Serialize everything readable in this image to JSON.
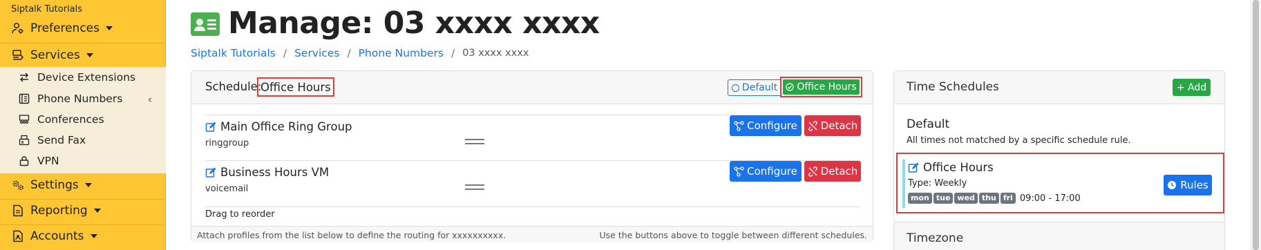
{
  "sidebar": {
    "brand": "Siptalk Tutorials",
    "items": [
      {
        "label": "Preferences",
        "icon": "user-gear-icon"
      },
      {
        "label": "Services",
        "icon": "services-icon"
      },
      {
        "label": "Settings",
        "icon": "gears-icon"
      },
      {
        "label": "Reporting",
        "icon": "report-icon"
      },
      {
        "label": "Accounts",
        "icon": "accounts-icon"
      }
    ],
    "services_submenu": [
      {
        "label": "Device Extensions",
        "icon": "arrows-exchange-icon"
      },
      {
        "label": "Phone Numbers",
        "icon": "phone-numbers-icon"
      },
      {
        "label": "Conferences",
        "icon": "conference-icon"
      },
      {
        "label": "Send Fax",
        "icon": "fax-icon"
      },
      {
        "label": "VPN",
        "icon": "lock-icon"
      }
    ]
  },
  "header": {
    "title": "Manage: 03 xxxx xxxx",
    "icon": "id-card-icon",
    "breadcrumb": [
      "Siptalk Tutorials",
      "Services",
      "Phone Numbers",
      "03 xxxx xxxx"
    ]
  },
  "schedule": {
    "label": "Schedule:",
    "name": "Office Hours",
    "toggle_default": "Default",
    "toggle_office": "Office Hours",
    "profiles": [
      {
        "name": "Main Office Ring Group",
        "type": "ringgroup"
      },
      {
        "name": "Business Hours VM",
        "type": "voicemail"
      }
    ],
    "configure_label": "Configure",
    "detach_label": "Detach",
    "drag_text": "Drag to reorder",
    "footer_left": "Attach profiles from the list below to define the routing for xxxxxxxxxx.",
    "footer_right": "Use the buttons above to toggle between different schedules."
  },
  "time_schedules": {
    "title": "Time Schedules",
    "add_label": "+ Add",
    "default_title": "Default",
    "default_desc": "All times not matched by a specific schedule rule.",
    "office": {
      "name": "Office Hours",
      "type": "Type: Weekly",
      "days": [
        "mon",
        "tue",
        "wed",
        "thu",
        "fri"
      ],
      "hours": "09:00 - 17:00",
      "rules_label": "Rules"
    }
  },
  "timezone": {
    "title": "Timezone"
  },
  "colors": {
    "sidebar": "#fdc632",
    "primary": "#1a73e8",
    "success": "#28a745",
    "danger": "#dc3545",
    "highlight": "#e53935"
  }
}
